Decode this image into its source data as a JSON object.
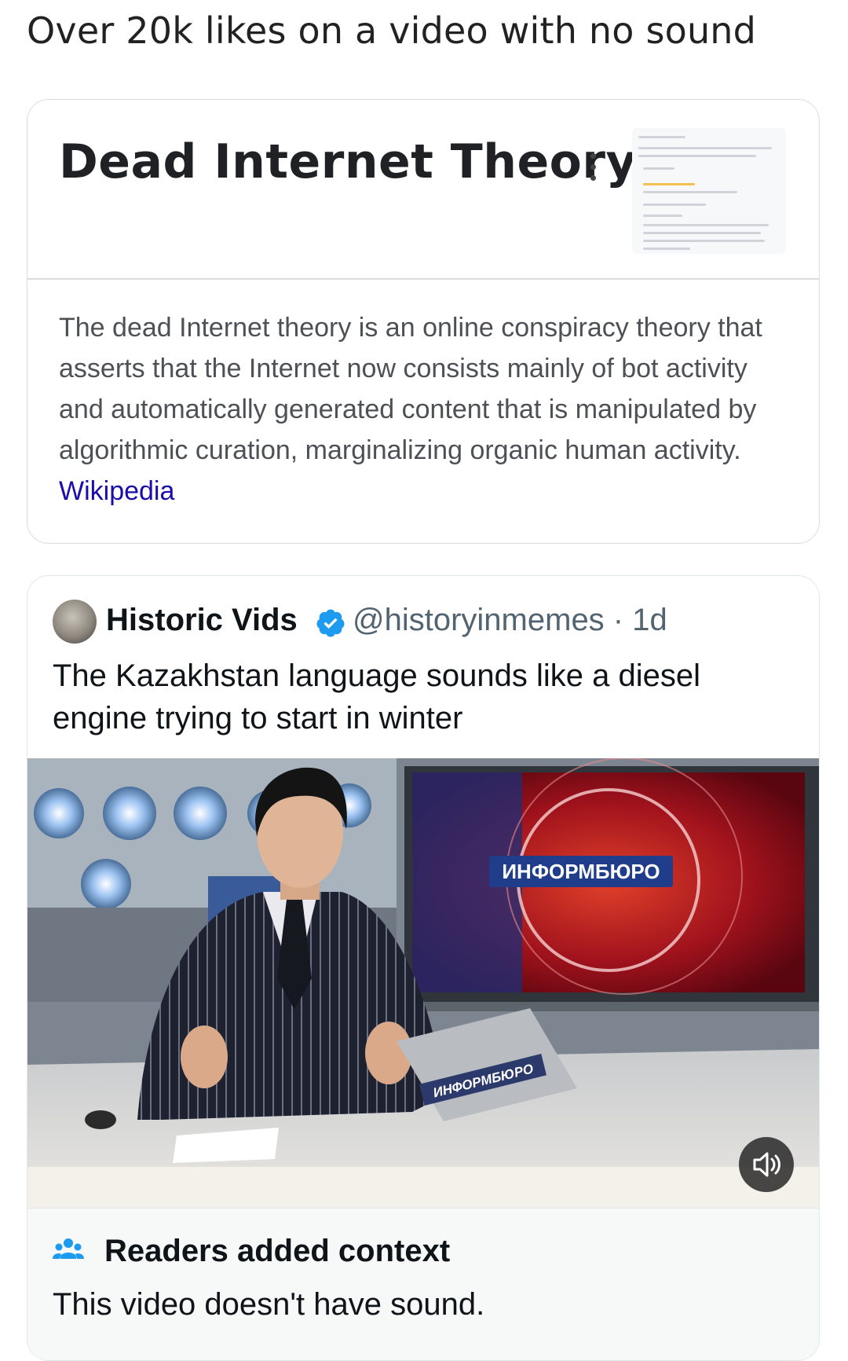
{
  "caption": "Over 20k likes on a video with no sound",
  "knowledge_panel": {
    "title": "Dead Internet Theory",
    "description": "The dead Internet theory is an online conspiracy theory that asserts that the Internet now consists mainly of bot activity and automatically generated content that is manipulated by algorithmic curation, marginalizing organic human activity.",
    "source_link": "Wikipedia"
  },
  "tweet": {
    "author_name": "Historic Vids",
    "handle_time": "@historyinmemes · 1d",
    "text": "The Kazakhstan language sounds like a diesel engine trying to start in winter",
    "video": {
      "screen_logo": "ИНФОРМБЮРО",
      "laptop_logo": "ИНФОРМБЮРО"
    },
    "community_note": {
      "title": "Readers added context",
      "text": "This video doesn't have sound."
    }
  },
  "colors": {
    "link": "#1a0dab",
    "verified": "#1d9bf0",
    "note_icon": "#1d9bf0"
  }
}
